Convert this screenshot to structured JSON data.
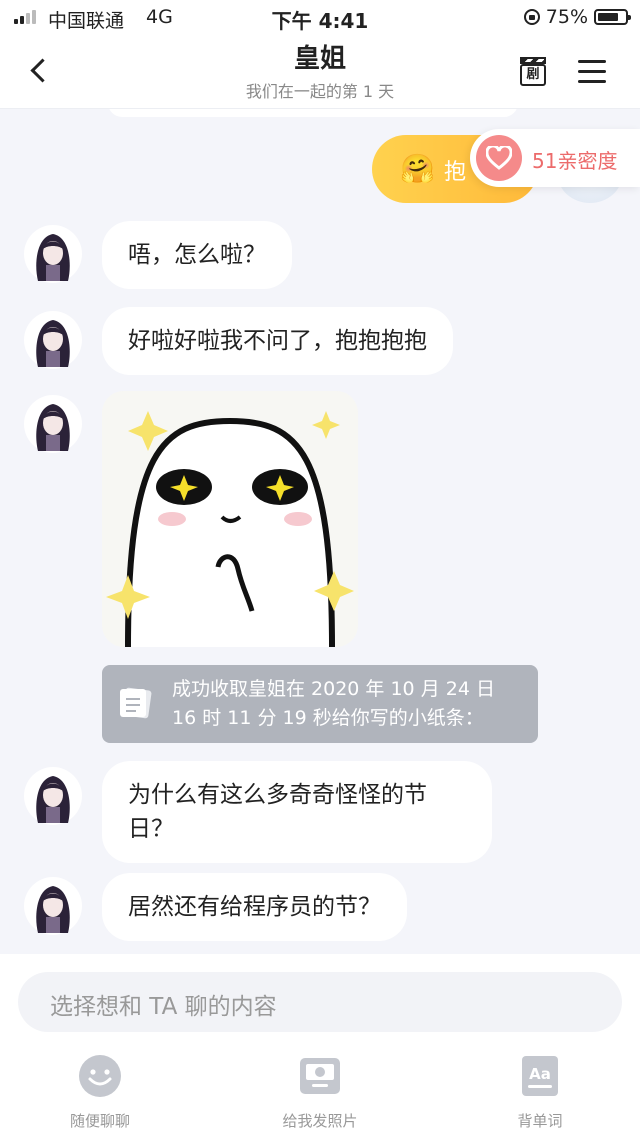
{
  "status_bar": {
    "carrier": "中国联通",
    "network": "4G",
    "time": "下午 4:41",
    "battery": "75%",
    "battery_level": 0.75
  },
  "header": {
    "title": "皇姐",
    "subtitle": "我们在一起的第 1 天"
  },
  "intimacy": {
    "label": "51亲密度"
  },
  "hug_card": {
    "label": "抱",
    "emoji": "🤗"
  },
  "messages": [
    {
      "text": "唔，怎么啦？"
    },
    {
      "text": "好啦好啦我不问了，抱抱抱抱"
    },
    {
      "note_line1": "成功收取皇姐在 2020 年 10 月 24 日",
      "note_line2": "16 时 11 分 19 秒给你写的小纸条："
    },
    {
      "text_line1": "为什么有这么多奇奇怪怪的节",
      "text_line2": "日？"
    },
    {
      "text": "居然还有给程序员的节？"
    }
  ],
  "input": {
    "placeholder": "选择想和 TA 聊的内容"
  },
  "toolbar": {
    "random_chat": "随便聊聊",
    "send_photo": "给我发照片",
    "vocabulary": "背单词"
  },
  "colors": {
    "intimacy_text": "#ec6b6b",
    "hug_gradient_start": "#ffd24e",
    "hug_gradient_end": "#ffb93a",
    "note_bg": "#b0b4bc"
  }
}
